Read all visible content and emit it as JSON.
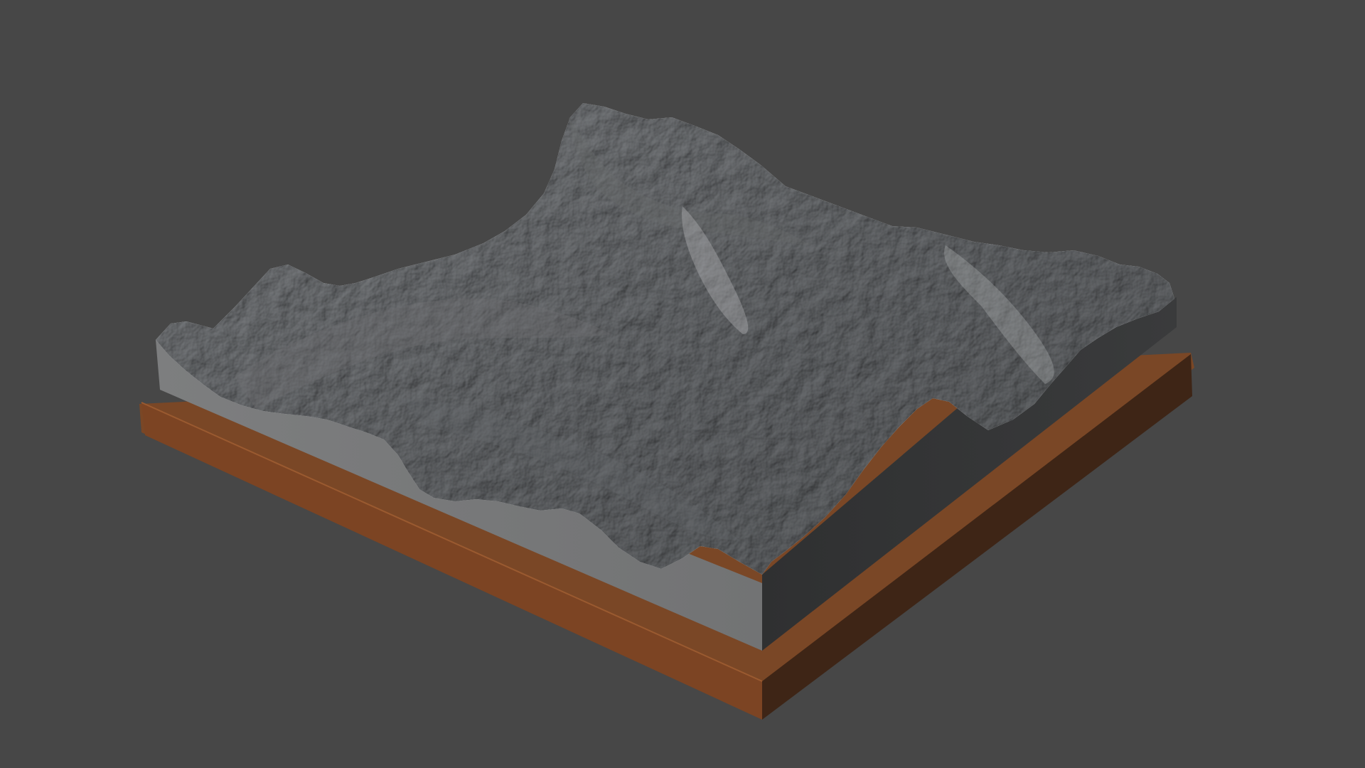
{
  "viewport": {
    "background_color": "#474747"
  },
  "model": {
    "subject": "terrain-relief-model",
    "base_colors": {
      "top": "#7a4726",
      "front": "#7c4423",
      "side": "#3e2516"
    },
    "block_colors": {
      "front": "#7b7c7d",
      "side": "#333435"
    },
    "terrain_colors": {
      "light": "#a4a6a8",
      "mid": "#8a8c8e",
      "dark": "#5e6062"
    }
  }
}
